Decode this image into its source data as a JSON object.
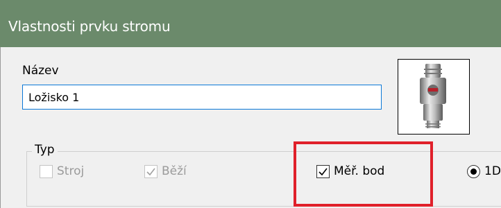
{
  "window": {
    "title": "Vlastnosti prvku stromu"
  },
  "name_field": {
    "label": "Název",
    "value": "Ložisko 1"
  },
  "image": {
    "icon": "sensor-image"
  },
  "type_group": {
    "legend": "Typ",
    "checkboxes": [
      {
        "label": "Stroj",
        "checked": false,
        "enabled": false
      },
      {
        "label": "Běží",
        "checked": true,
        "enabled": false
      },
      {
        "label": "Měř. bod",
        "checked": true,
        "enabled": true
      }
    ],
    "radio": {
      "label": "1D",
      "selected": true
    }
  },
  "highlight_color": "#e0202a",
  "titlebar_color": "#6b8a6b"
}
